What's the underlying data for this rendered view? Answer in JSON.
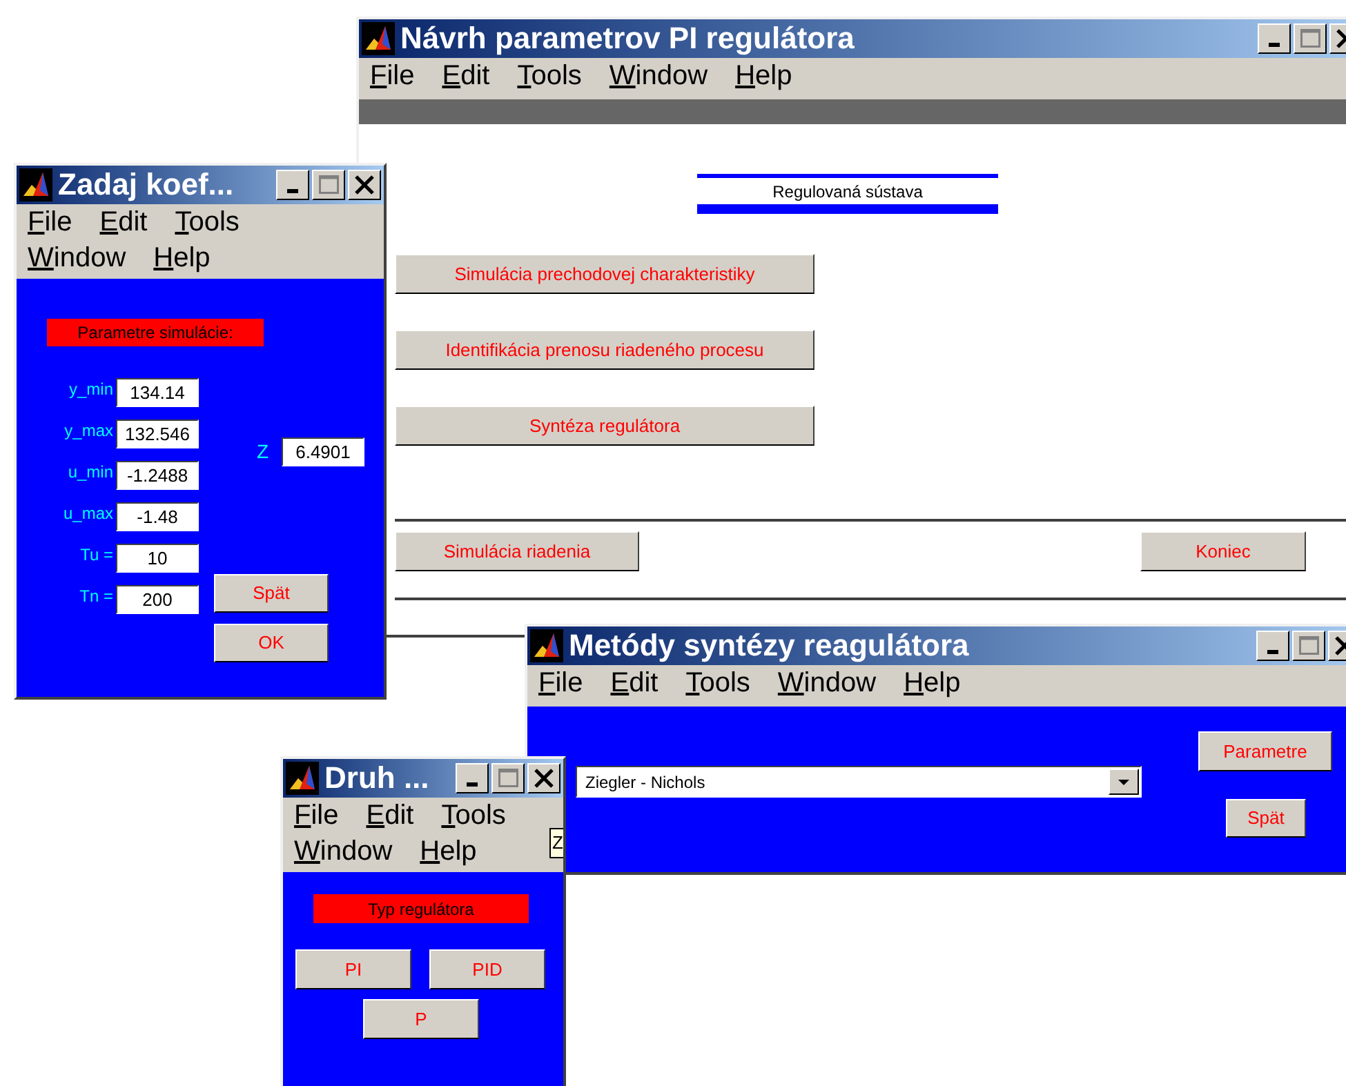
{
  "main_window": {
    "title": "Návrh parametrov PI regulátora",
    "menu": [
      "File",
      "Edit",
      "Tools",
      "Window",
      "Help"
    ],
    "section_label": "Regulovaná sústava",
    "buttons": [
      "Simulácia prechodovej charakteristiky",
      "Identifikácia prenosu riadeného procesu",
      "Syntéza regulátora"
    ],
    "bottom_buttons": [
      "Simulácia riadenia",
      "Koniec"
    ]
  },
  "coefficients_window": {
    "title": "Zadaj koef...",
    "menu": [
      "File",
      "Edit",
      "Tools",
      "Window",
      "Help"
    ],
    "heading": "Parametre simulácie:",
    "fields": [
      {
        "label": "y_min",
        "value": "134.14"
      },
      {
        "label": "y_max",
        "value": "132.546"
      },
      {
        "label": "u_min",
        "value": "-1.2488"
      },
      {
        "label": "u_max",
        "value": "-1.48"
      },
      {
        "label": "Tu =",
        "value": "10"
      },
      {
        "label": "Tn =",
        "value": "200"
      }
    ],
    "z_field": {
      "label": "Z",
      "value": "6.4901"
    },
    "buttons": [
      "Spät",
      "OK"
    ]
  },
  "methods_window": {
    "title": "Metódy syntézy reagulátora",
    "menu": [
      "File",
      "Edit",
      "Tools",
      "Window",
      "Help"
    ],
    "method_dropdown": {
      "value": "Ziegler - Nichols"
    },
    "buttons": [
      "Parametre",
      "Spät"
    ]
  },
  "type_window": {
    "title": "Druh ...",
    "menu": [
      "File",
      "Edit",
      "Tools",
      "Window",
      "Help"
    ],
    "heading": "Typ regulátora",
    "buttons": [
      "PI",
      "PID",
      "P"
    ],
    "fragment": "Z"
  }
}
